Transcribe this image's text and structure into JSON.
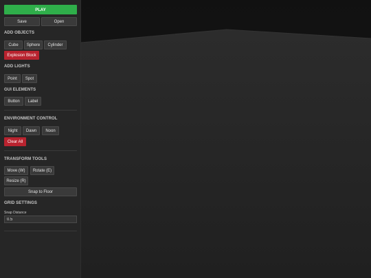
{
  "toolbar": {
    "play_label": "PLAY",
    "save_label": "Save",
    "open_label": "Open"
  },
  "add_objects": {
    "title": "ADD OBJECTS",
    "cube": "Cube",
    "sphere": "Sphere",
    "cylinder": "Cylinder",
    "explosion_block": "Explosion Block"
  },
  "add_lights": {
    "title": "ADD LIGHTS",
    "point": "Point",
    "spot": "Spot"
  },
  "gui_elements": {
    "title": "GUI ELEMENTS",
    "button": "Button",
    "label": "Label"
  },
  "environment": {
    "title": "ENVIRONMENT CONTROL",
    "night": "Night",
    "dawn": "Dawn",
    "noon": "Noon",
    "clear_all": "Clear All"
  },
  "transform": {
    "title": "TRANSFORM TOOLS",
    "move": "Move (W)",
    "rotate": "Rotate (E)",
    "resize": "Resize (R)",
    "snap_to_floor": "Snap to Floor"
  },
  "grid": {
    "title": "GRID SETTINGS",
    "snap_distance_label": "Snap Distance",
    "snap_distance_value": "0.5"
  },
  "colors": {
    "play": "#2fae4a",
    "danger": "#b8232f",
    "panel": "#262626",
    "floor": "#2b2b2b",
    "sky": "#141414"
  }
}
